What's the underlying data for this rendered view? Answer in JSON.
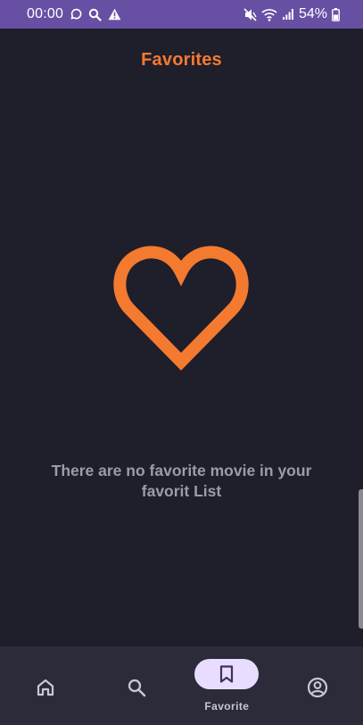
{
  "status_bar": {
    "time": "00:00",
    "battery": "54%",
    "icons_left": [
      "whatsapp-icon",
      "search-icon",
      "warning-icon"
    ],
    "icons_right": [
      "mute-icon",
      "wifi-icon",
      "signal-icon",
      "battery-icon"
    ],
    "background": "#6750a4"
  },
  "page": {
    "title": "Favorites",
    "empty_message": "There are no favorite movie in your favorit List",
    "accent_color": "#f47a2f",
    "empty_icon": "heart-outline-icon"
  },
  "bottom_nav": {
    "items": [
      {
        "icon": "home-icon",
        "label": "",
        "selected": false
      },
      {
        "icon": "search-icon",
        "label": "",
        "selected": false
      },
      {
        "icon": "bookmark-icon",
        "label": "Favorite",
        "selected": true
      },
      {
        "icon": "account-icon",
        "label": "",
        "selected": false
      }
    ]
  }
}
